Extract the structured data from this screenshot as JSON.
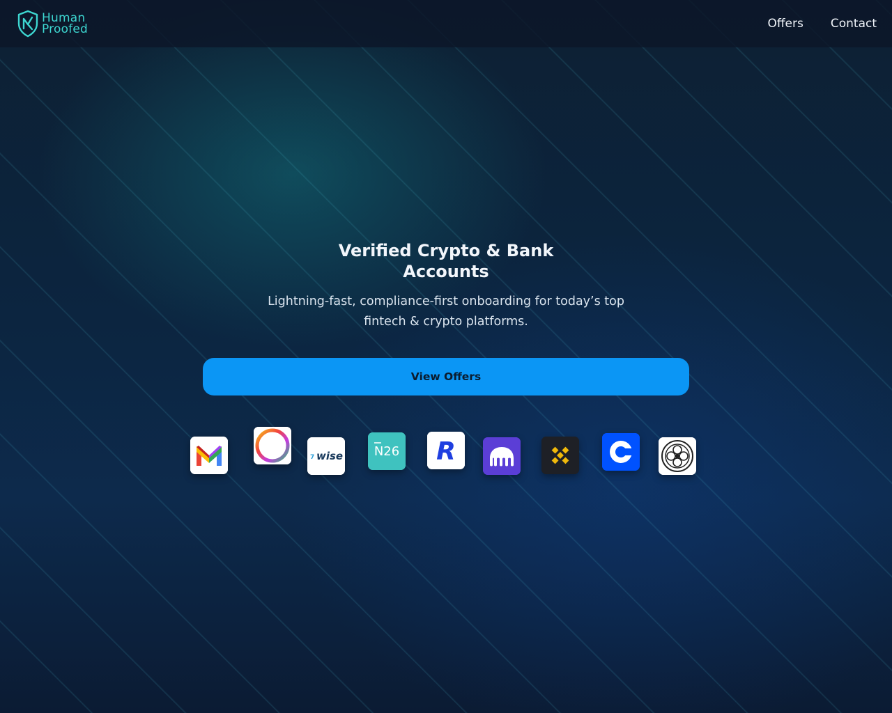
{
  "brand": {
    "name_line1": "Human",
    "name_line2": "Proofed"
  },
  "nav": {
    "items": [
      {
        "label": "Offers"
      },
      {
        "label": "Contact"
      }
    ]
  },
  "hero": {
    "title": "Verified Crypto & Bank Accounts",
    "subtitle": "Lightning-fast, compliance-first onboarding for today’s top fintech & crypto platforms.",
    "cta_label": "View Offers"
  },
  "partners": [
    {
      "icon": "gmail-icon",
      "text": ""
    },
    {
      "icon": "ring-logo-icon",
      "text": ""
    },
    {
      "icon": "wise-icon",
      "text": "wise"
    },
    {
      "icon": "n26-icon",
      "text": "N26"
    },
    {
      "icon": "revolut-icon",
      "text": "R"
    },
    {
      "icon": "kraken-icon",
      "text": ""
    },
    {
      "icon": "binance-icon",
      "text": ""
    },
    {
      "icon": "coinbase-icon",
      "text": ""
    },
    {
      "icon": "ornament-logo-icon",
      "text": ""
    }
  ],
  "colors": {
    "accent": "#0b96f5",
    "brand": "#3dd6d0",
    "background": "#0c2540"
  }
}
